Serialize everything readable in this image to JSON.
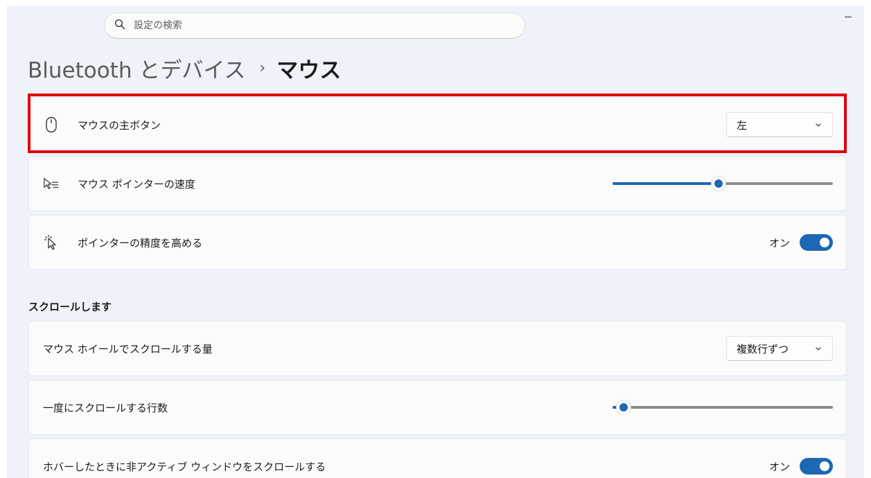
{
  "search": {
    "placeholder": "設定の検索"
  },
  "breadcrumb": {
    "parent": "Bluetooth とデバイス",
    "separator": "›",
    "current": "マウス"
  },
  "settings": {
    "primary_button": {
      "label": "マウスの主ボタン",
      "value": "左",
      "icon": "mouse-icon"
    },
    "pointer_speed": {
      "label": "マウス ポインターの速度",
      "value_fraction": 0.48,
      "icon": "pointer-speed-icon"
    },
    "pointer_precision": {
      "label": "ポインターの精度を高める",
      "state": "オン",
      "icon": "pointer-precision-icon"
    }
  },
  "scroll": {
    "title": "スクロールします",
    "wheel_amount": {
      "label": "マウス ホイールでスクロールする量",
      "value": "複数行ずつ"
    },
    "lines_per_scroll": {
      "label": "一度にスクロールする行数",
      "value_fraction": 0.05
    },
    "inactive_scroll": {
      "label": "ホバーしたときに非アクティブ ウィンドウをスクロールする",
      "state": "オン"
    }
  },
  "colors": {
    "accent": "#1d67b4",
    "highlight_border": "#e0000b",
    "background": "#eff3f9"
  }
}
